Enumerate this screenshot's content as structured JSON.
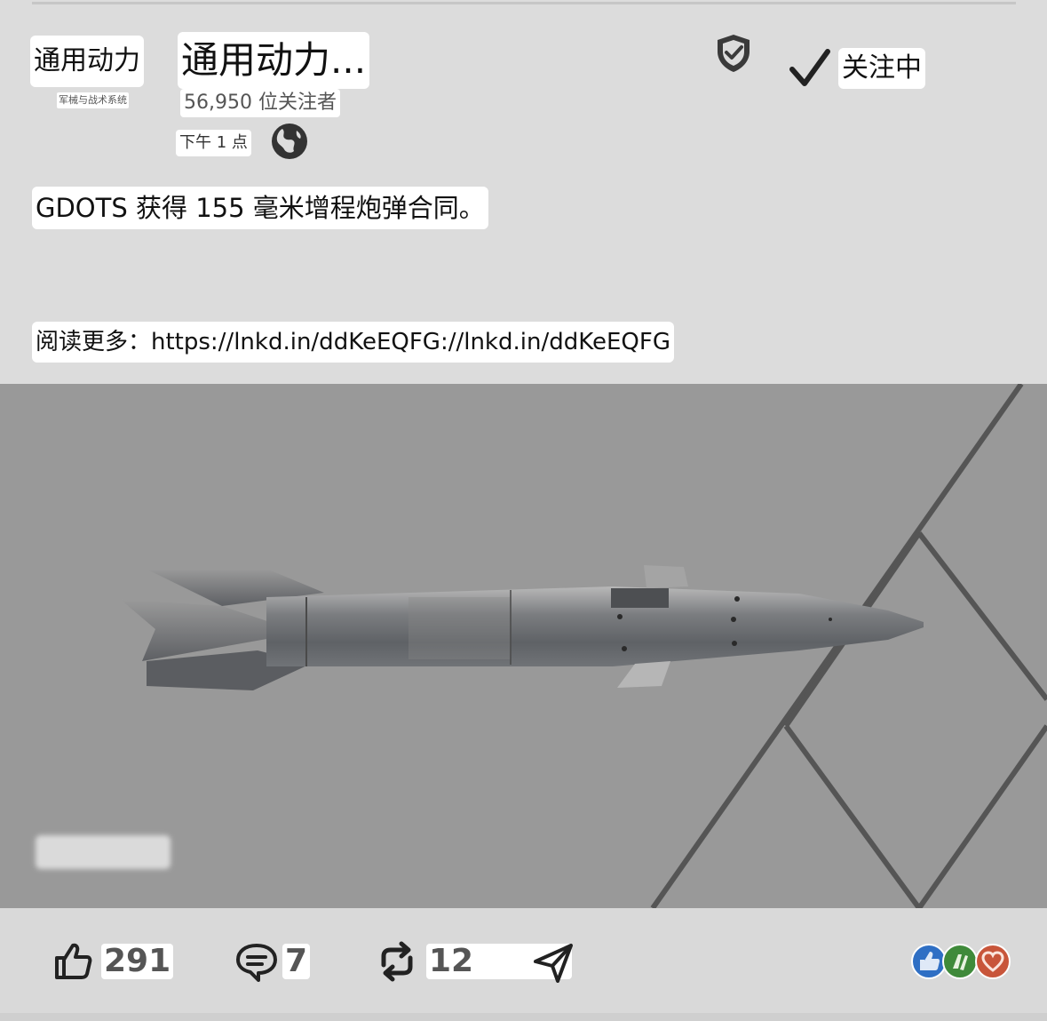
{
  "post": {
    "author_logo_text": "通用动力",
    "author_logo_subtext": "军械与战术系统",
    "author_name": "通用动力...",
    "followers": "56,950 位关注者",
    "time": "下午 1 点",
    "follow_label": "关注中",
    "headline": "GDOTS 获得 155 毫米增程炮弹合同。",
    "read_more": "阅读更多：https://lnkd.in/ddKeEQFG://lnkd.in/ddKeEQFG"
  },
  "actions": {
    "likes": "291",
    "comments": "7",
    "reposts": "12"
  },
  "icons": {
    "globe": "globe-icon",
    "shield": "verified-shield-icon",
    "check": "checkmark-icon",
    "like": "thumbs-up-icon",
    "comment": "comment-icon",
    "repost": "repost-icon",
    "send": "send-icon",
    "reactions": [
      "like-reaction-icon",
      "celebrate-reaction-icon",
      "love-reaction-icon"
    ]
  },
  "colors": {
    "like_reaction": "#2f6fc4",
    "celebrate_reaction": "#3f8a3a",
    "love_reaction": "#c8553a",
    "media_background": "#999999"
  }
}
